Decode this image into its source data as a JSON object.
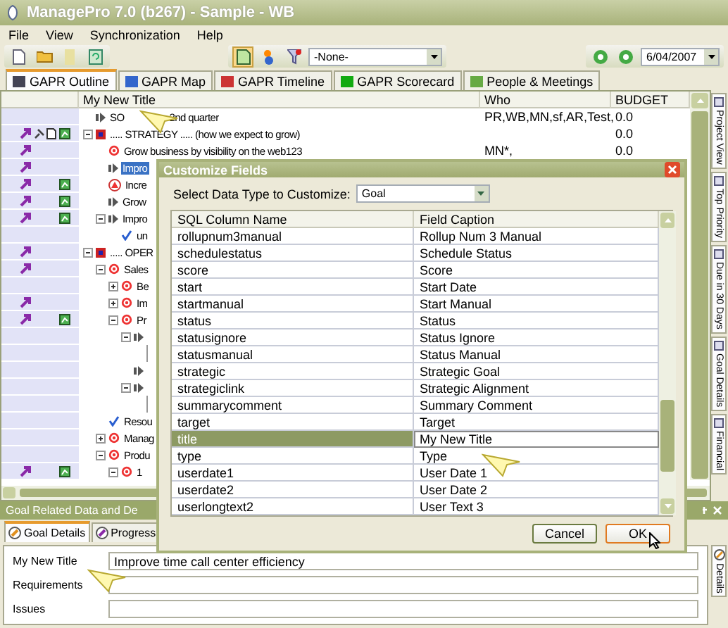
{
  "window": {
    "title": "ManagePro 7.0 (b267) - Sample - WB"
  },
  "menu": [
    "File",
    "View",
    "Synchronization",
    "Help"
  ],
  "toolbar": {
    "filter": "-None-",
    "date": "6/04/2007"
  },
  "tabs": [
    {
      "label": "GAPR Outline",
      "selected": true
    },
    {
      "label": "GAPR Map",
      "selected": false
    },
    {
      "label": "GAPR Timeline",
      "selected": false
    },
    {
      "label": "GAPR Scorecard",
      "selected": false
    },
    {
      "label": "People & Meetings",
      "selected": false
    }
  ],
  "outline": {
    "columns": [
      "My New Title",
      "Who",
      "BUDGET"
    ],
    "items": [
      {
        "text": "SO",
        "text_2": "2nd quarter",
        "kind": "step",
        "who": "PR,WB,MN,sf,AR,Test,",
        "budget": "0.0",
        "selected": false
      },
      {
        "text": "..... STRATEGY .....  (how we expect to grow)",
        "kind": "section",
        "indicators": [
          {
            "kind": "link"
          },
          {
            "kind": "pin"
          },
          {
            "kind": "document"
          },
          {
            "kind": "chart"
          }
        ],
        "budget": "0.0",
        "selected": false,
        "expanded": true,
        "children": [
          {
            "text": "Grow business by visibility on the web123",
            "kind": "goal",
            "indicators": [
              {
                "kind": "link"
              }
            ],
            "who": "MN*,",
            "budget": "0.0",
            "selected": false
          },
          {
            "text": "Impro",
            "kind": "step",
            "indicators": [
              {
                "kind": "link"
              }
            ],
            "selected": true
          },
          {
            "text": "Incre",
            "kind": "alert",
            "indicators": [
              {
                "kind": "link"
              },
              {
                "kind": "chart"
              }
            ],
            "selected": false
          },
          {
            "text": "Grow",
            "kind": "step",
            "indicators": [
              {
                "kind": "link"
              },
              {
                "kind": "chart"
              }
            ],
            "selected": false
          },
          {
            "text": "Impro",
            "kind": "step",
            "indicators": [
              {
                "kind": "link"
              },
              {
                "kind": "chart"
              }
            ],
            "selected": false,
            "expanded": true,
            "children": [
              {
                "text": "un",
                "kind": "done",
                "selected": false
              }
            ]
          }
        ]
      },
      {
        "text": "..... OPER",
        "kind": "section",
        "indicators": [
          {
            "kind": "link"
          }
        ],
        "selected": false,
        "expanded": true,
        "children": [
          {
            "text": "Sales",
            "kind": "goal",
            "indicators": [
              {
                "kind": "link"
              }
            ],
            "selected": false,
            "expanded": true,
            "children": [
              {
                "text": "Be",
                "kind": "goal",
                "selected": false,
                "expanded": false
              },
              {
                "text": "Im",
                "kind": "goal",
                "indicators": [
                  {
                    "kind": "link"
                  }
                ],
                "selected": false,
                "expanded": false
              },
              {
                "text": "Pr",
                "kind": "goal",
                "indicators": [
                  {
                    "kind": "link"
                  },
                  {
                    "kind": "chart"
                  }
                ],
                "selected": false,
                "expanded": true,
                "children": [
                  {
                    "kind": "step",
                    "expanded": true,
                    "children": [
                      {
                        "kind": "line"
                      }
                    ]
                  },
                  {
                    "kind": "step"
                  },
                  {
                    "kind": "step",
                    "expanded": true,
                    "children": [
                      {
                        "kind": "line"
                      }
                    ]
                  }
                ]
              }
            ]
          },
          {
            "text": "Resou",
            "kind": "done",
            "selected": false
          },
          {
            "text": "Manag",
            "kind": "goal",
            "selected": false,
            "expanded": false
          },
          {
            "text": "Produ",
            "kind": "goal",
            "selected": false,
            "expanded": true,
            "children": [
              {
                "text": "1",
                "kind": "goal",
                "indicators": [
                  {
                    "kind": "link"
                  },
                  {
                    "kind": "chart"
                  }
                ],
                "selected": false,
                "expanded": true
              }
            ]
          }
        ]
      }
    ]
  },
  "side_tabs": [
    "Project View",
    "Top Priority",
    "Due in 30 Days",
    "Goal Details",
    "Financial"
  ],
  "details": {
    "title": "Goal Related Data and De",
    "tabs": [
      {
        "label": "Goal Details",
        "selected": true
      },
      {
        "label": "Progress",
        "selected": false
      }
    ],
    "fields": [
      {
        "label": "My New Title",
        "value": "Improve time call center efficiency"
      },
      {
        "label": "Requirements"
      },
      {
        "label": "Issues"
      }
    ],
    "side_tab": "Details"
  },
  "dialog": {
    "title": "Customize Fields",
    "select_label": "Select Data Type to Customize:",
    "select_value": "Goal",
    "columns": [
      "SQL Column Name",
      "Field Caption"
    ],
    "rows": [
      {
        "column": "rollupnum3manual",
        "caption": "Rollup Num 3 Manual",
        "selected": false
      },
      {
        "column": "schedulestatus",
        "caption": "Schedule Status",
        "selected": false
      },
      {
        "column": "score",
        "caption": "Score",
        "selected": false
      },
      {
        "column": "start",
        "caption": "Start Date",
        "selected": false
      },
      {
        "column": "startmanual",
        "caption": "Start Manual",
        "selected": false
      },
      {
        "column": "status",
        "caption": "Status",
        "selected": false
      },
      {
        "column": "statusignore",
        "caption": "Status Ignore",
        "selected": false
      },
      {
        "column": "statusmanual",
        "caption": "Status Manual",
        "selected": false
      },
      {
        "column": "strategic",
        "caption": "Strategic Goal",
        "selected": false
      },
      {
        "column": "strategiclink",
        "caption": "Strategic Alignment",
        "selected": false
      },
      {
        "column": "summarycomment",
        "caption": "Summary Comment",
        "selected": false
      },
      {
        "column": "target",
        "caption": "Target",
        "selected": false
      },
      {
        "column": "title",
        "caption": "My New Title",
        "selected": true
      },
      {
        "column": "type",
        "caption": "Type",
        "selected": false
      },
      {
        "column": "userdate1",
        "caption": "User Date 1",
        "selected": false
      },
      {
        "column": "userdate2",
        "caption": "User Date 2",
        "selected": false
      },
      {
        "column": "userlongtext2",
        "caption": "User Text 3",
        "selected": false
      }
    ],
    "buttons": [
      "Cancel",
      "OK"
    ]
  }
}
